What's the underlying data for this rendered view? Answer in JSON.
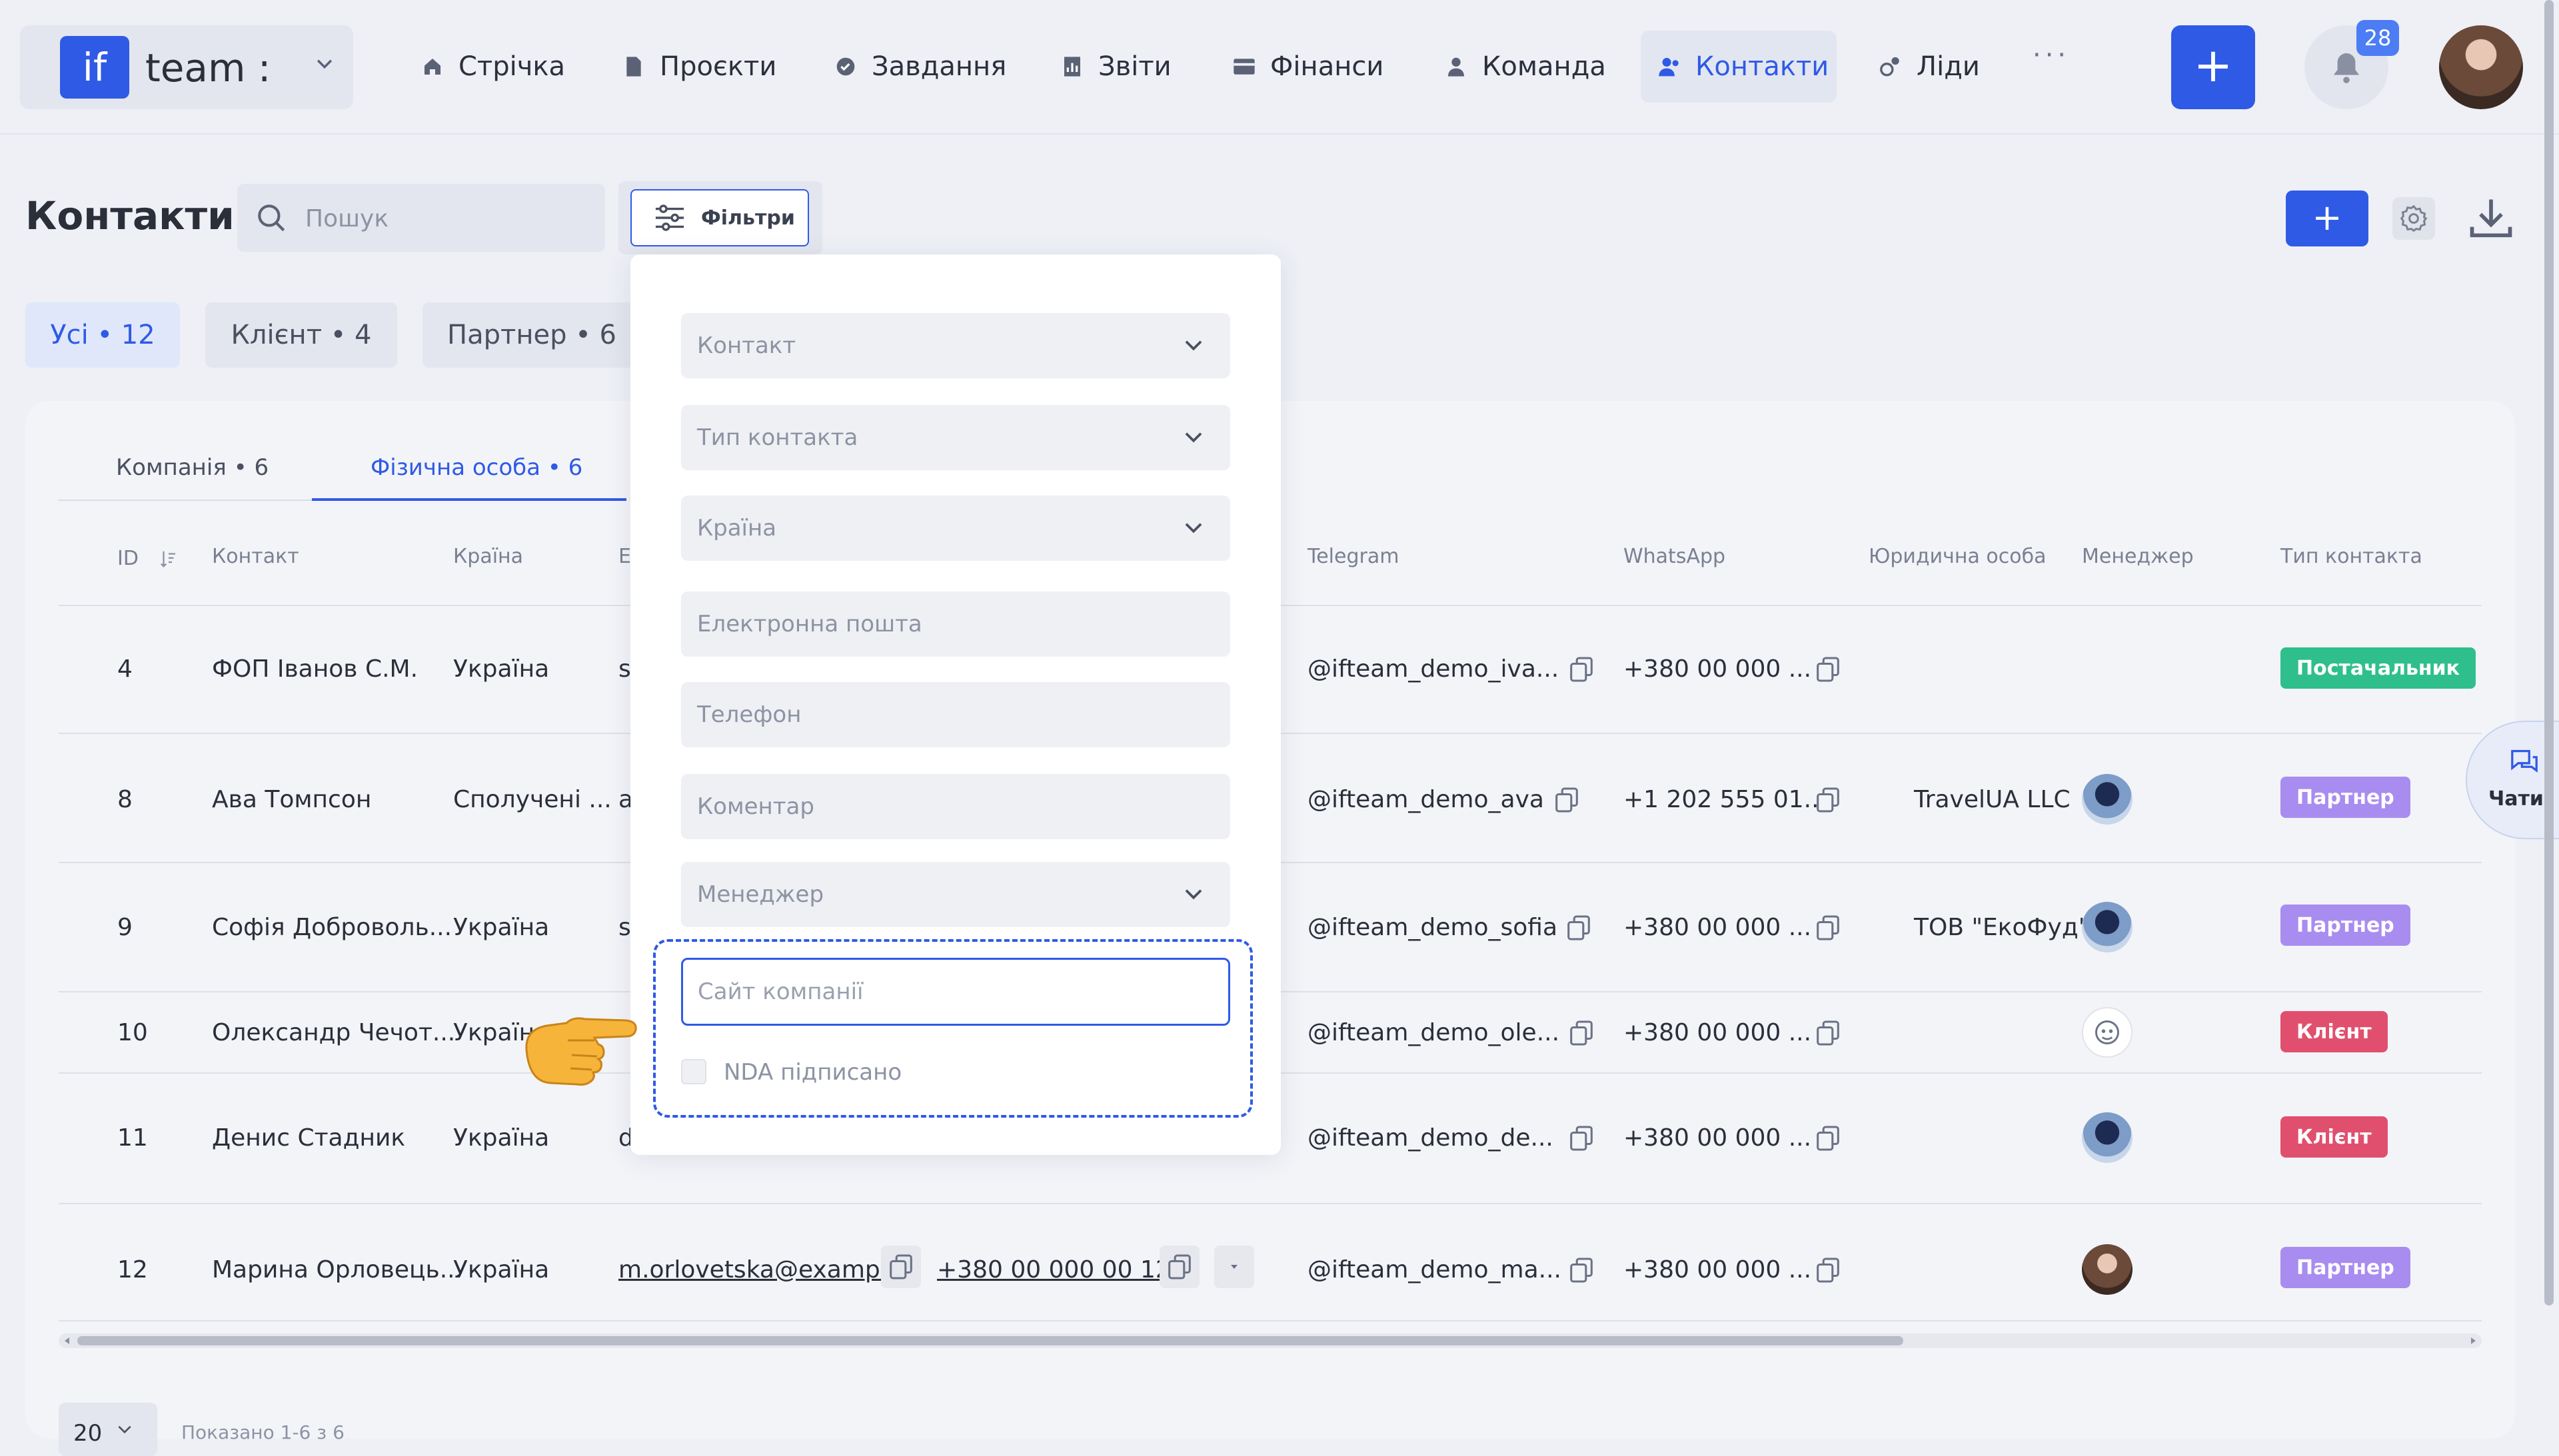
{
  "brand": {
    "logo_text": "if",
    "name": "team :"
  },
  "nav": {
    "items": [
      {
        "label": "Стрічка",
        "icon": "home-icon"
      },
      {
        "label": "Проєкти",
        "icon": "file-icon"
      },
      {
        "label": "Завдання",
        "icon": "check-circle-icon"
      },
      {
        "label": "Звіти",
        "icon": "chart-icon"
      },
      {
        "label": "Фінанси",
        "icon": "wallet-icon"
      },
      {
        "label": "Команда",
        "icon": "user-icon"
      },
      {
        "label": "Контакти",
        "icon": "contacts-icon",
        "active": true
      },
      {
        "label": "Ліди",
        "icon": "leads-icon"
      }
    ],
    "more": "···",
    "add_label": "+",
    "notifications_count": "28"
  },
  "header": {
    "title": "Контакти",
    "search_placeholder": "Пошук",
    "filters_label": "Фільтри",
    "add_label": "+"
  },
  "segments": [
    {
      "label": "Усі • 12",
      "active": true
    },
    {
      "label": "Клієнт • 4"
    },
    {
      "label": "Партнер • 6"
    }
  ],
  "subtabs": [
    {
      "label": "Компанія • 6"
    },
    {
      "label": "Фізична особа • 6",
      "active": true
    }
  ],
  "table": {
    "columns": {
      "id": "ID",
      "contact": "Контакт",
      "country": "Країна",
      "email": "Е",
      "telegram": "Telegram",
      "whatsapp": "WhatsApp",
      "legal": "Юридична особа",
      "manager": "Менеджер",
      "type": "Тип контакта"
    },
    "rows": [
      {
        "id": "4",
        "contact": "ФОП Іванов С.М.",
        "country": "Україна",
        "email_frag": "s",
        "telegram": "@ifteam_demo_iva...",
        "whatsapp": "+380 00 000 ...",
        "legal": "",
        "type": "Постачальник"
      },
      {
        "id": "8",
        "contact": "Ава Томпсон",
        "country": "Сполучені ...",
        "email_frag": "a",
        "telegram": "@ifteam_demo_ava",
        "whatsapp": "+1 202 555 01...",
        "legal": "TravelUA LLC",
        "type": "Партнер"
      },
      {
        "id": "9",
        "contact": "Софія Доброволь...",
        "country": "Україна",
        "email_frag": "s",
        "telegram": "@ifteam_demo_sofia",
        "whatsapp": "+380 00 000 ...",
        "legal": "ТОВ \"ЕкоФуд\"",
        "type": "Партнер"
      },
      {
        "id": "10",
        "contact": "Олександр Чечот...",
        "country": "Україна",
        "email_frag": "",
        "telegram": "@ifteam_demo_ole...",
        "whatsapp": "+380 00 000 ...",
        "legal": "",
        "type": "Клієнт"
      },
      {
        "id": "11",
        "contact": "Денис Стадник",
        "country": "Україна",
        "email_frag": "d",
        "telegram": "@ifteam_demo_de...",
        "whatsapp": "+380 00 000 ...",
        "legal": "",
        "type": "Клієнт"
      },
      {
        "id": "12",
        "contact": "Марина Орловець...",
        "country": "Україна",
        "email": "m.orlovetska@examp...",
        "phone": "+380 00 000 00 12",
        "telegram": "@ifteam_demo_ma...",
        "whatsapp": "+380 00 000 ...",
        "legal": "",
        "type": "Партнер"
      }
    ]
  },
  "chats": {
    "label": "Чати"
  },
  "pager": {
    "page_size": "20",
    "shown": "Показано 1-6 з 6"
  },
  "filters_panel": {
    "contact": "Контакт",
    "contact_type": "Тип контакта",
    "country": "Країна",
    "email": "Електронна пошта",
    "phone": "Телефон",
    "comment": "Коментар",
    "manager": "Менеджер",
    "site": "Сайт компанії",
    "nda": "NDA підписано"
  },
  "colors": {
    "accent": "#2f5ae6",
    "supplier": "#2fbf8c",
    "partner": "#a98cf0",
    "client": "#e0506e"
  }
}
